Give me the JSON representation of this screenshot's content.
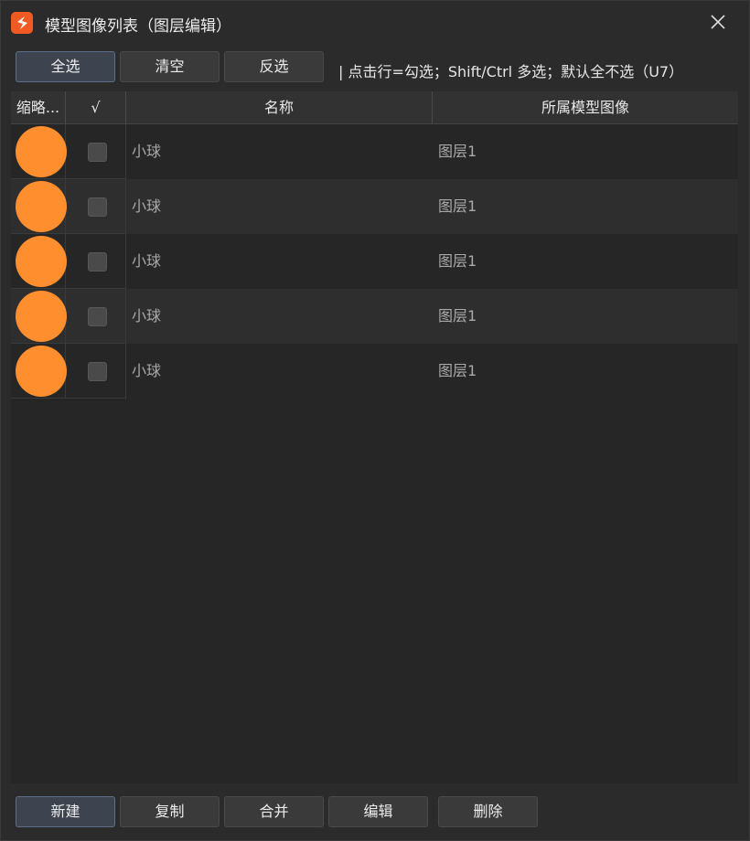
{
  "window": {
    "title": "模型图像列表（图层编辑）",
    "logo_icon": "app-logo-icon",
    "close_icon": "close-icon"
  },
  "toolbar": {
    "buttons": [
      {
        "label": "全选",
        "active": true
      },
      {
        "label": "清空",
        "active": false
      },
      {
        "label": "反选",
        "active": false
      }
    ],
    "hint": "| 点击行=勾选；Shift/Ctrl 多选；默认全不选（U7）"
  },
  "table": {
    "columns": [
      "缩略...",
      "√",
      "名称",
      "所属模型图像"
    ],
    "rows": [
      {
        "name": "小球",
        "layer": "图层1",
        "checked": false,
        "thumb_color": "#ff8f2e"
      },
      {
        "name": "小球",
        "layer": "图层1",
        "checked": false,
        "thumb_color": "#ff8f2e"
      },
      {
        "name": "小球",
        "layer": "图层1",
        "checked": false,
        "thumb_color": "#ff8f2e"
      },
      {
        "name": "小球",
        "layer": "图层1",
        "checked": false,
        "thumb_color": "#ff8f2e"
      },
      {
        "name": "小球",
        "layer": "图层1",
        "checked": false,
        "thumb_color": "#ff8f2e"
      }
    ]
  },
  "bottom": {
    "buttons": [
      "新建",
      "复制",
      "合并",
      "编辑",
      "删除"
    ]
  },
  "colors": {
    "accent": "#f25a24",
    "thumbnail": "#ff8f2e",
    "background": "#2b2b2b"
  }
}
